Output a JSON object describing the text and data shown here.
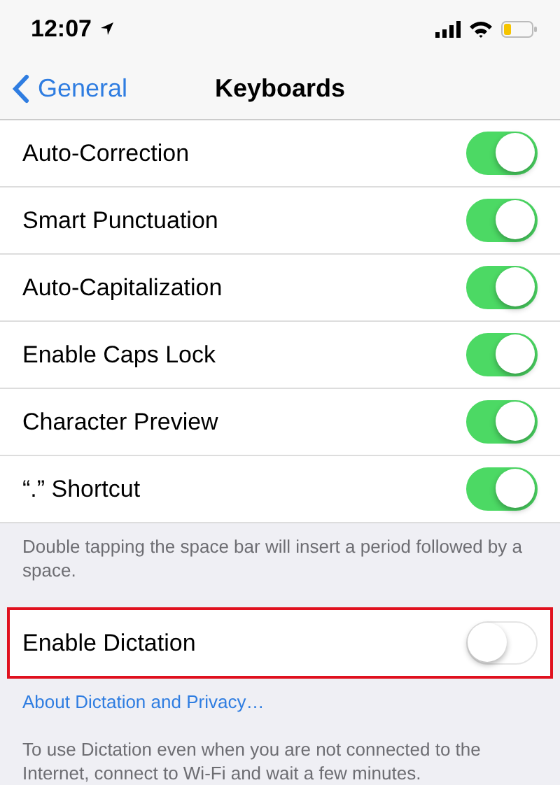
{
  "status_bar": {
    "time": "12:07"
  },
  "nav": {
    "back": "General",
    "title": "Keyboards"
  },
  "rows": [
    {
      "label": "Auto-Correction",
      "on": true
    },
    {
      "label": "Smart Punctuation",
      "on": true
    },
    {
      "label": "Auto-Capitalization",
      "on": true
    },
    {
      "label": "Enable Caps Lock",
      "on": true
    },
    {
      "label": "Character Preview",
      "on": true
    },
    {
      "label": "“.” Shortcut",
      "on": true
    }
  ],
  "rows_footer": "Double tapping the space bar will insert a period followed by a space.",
  "dictation": {
    "label": "Enable Dictation",
    "on": false,
    "highlighted": true
  },
  "link": "About Dictation and Privacy…",
  "note": "To use Dictation even when you are not connected to the Internet, connect to Wi-Fi and wait a few minutes."
}
